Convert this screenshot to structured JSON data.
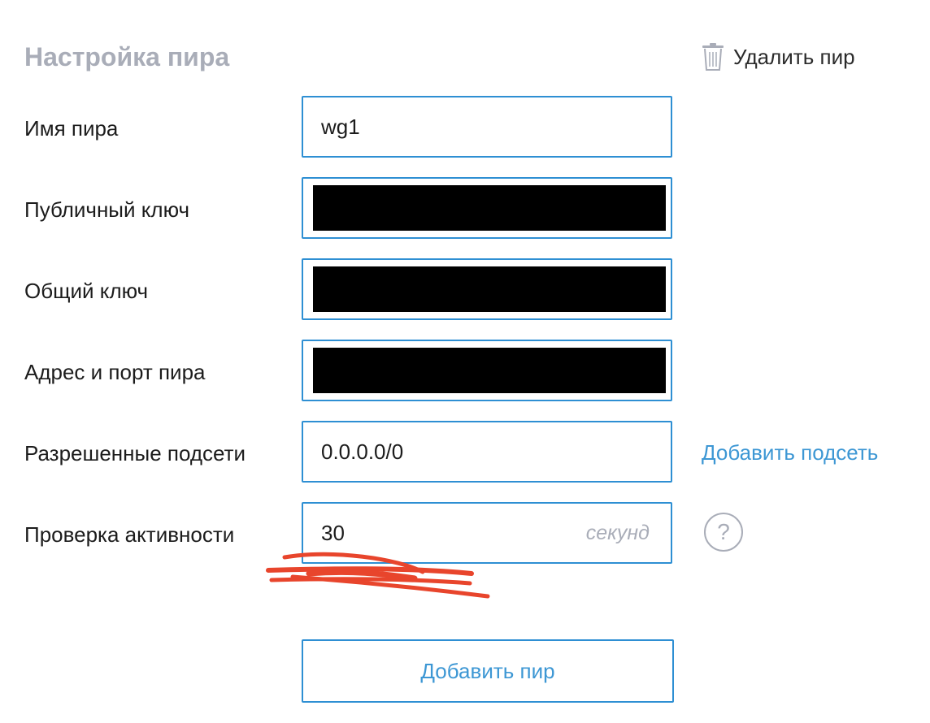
{
  "header": {
    "title": "Настройка пира",
    "delete_label": "Удалить пир",
    "delete_icon": "trash-icon"
  },
  "form": {
    "peer_name": {
      "label": "Имя пира",
      "value": "wg1"
    },
    "public_key": {
      "label": "Публичный ключ"
    },
    "shared_key": {
      "label": "Общий ключ"
    },
    "endpoint": {
      "label": "Адрес и порт пира"
    },
    "allowed_ips": {
      "label": "Разрешенные подсети",
      "value": "0.0.0.0/0",
      "add_label": "Добавить подсеть"
    },
    "keepalive": {
      "label": "Проверка активности",
      "value": "30",
      "unit": "секунд",
      "help_symbol": "?"
    }
  },
  "add_peer_label": "Добавить пир",
  "colors": {
    "accent": "#2e8fd3",
    "link": "#3d97d4",
    "muted": "#a9adb8",
    "annotation": "#e8452c"
  }
}
